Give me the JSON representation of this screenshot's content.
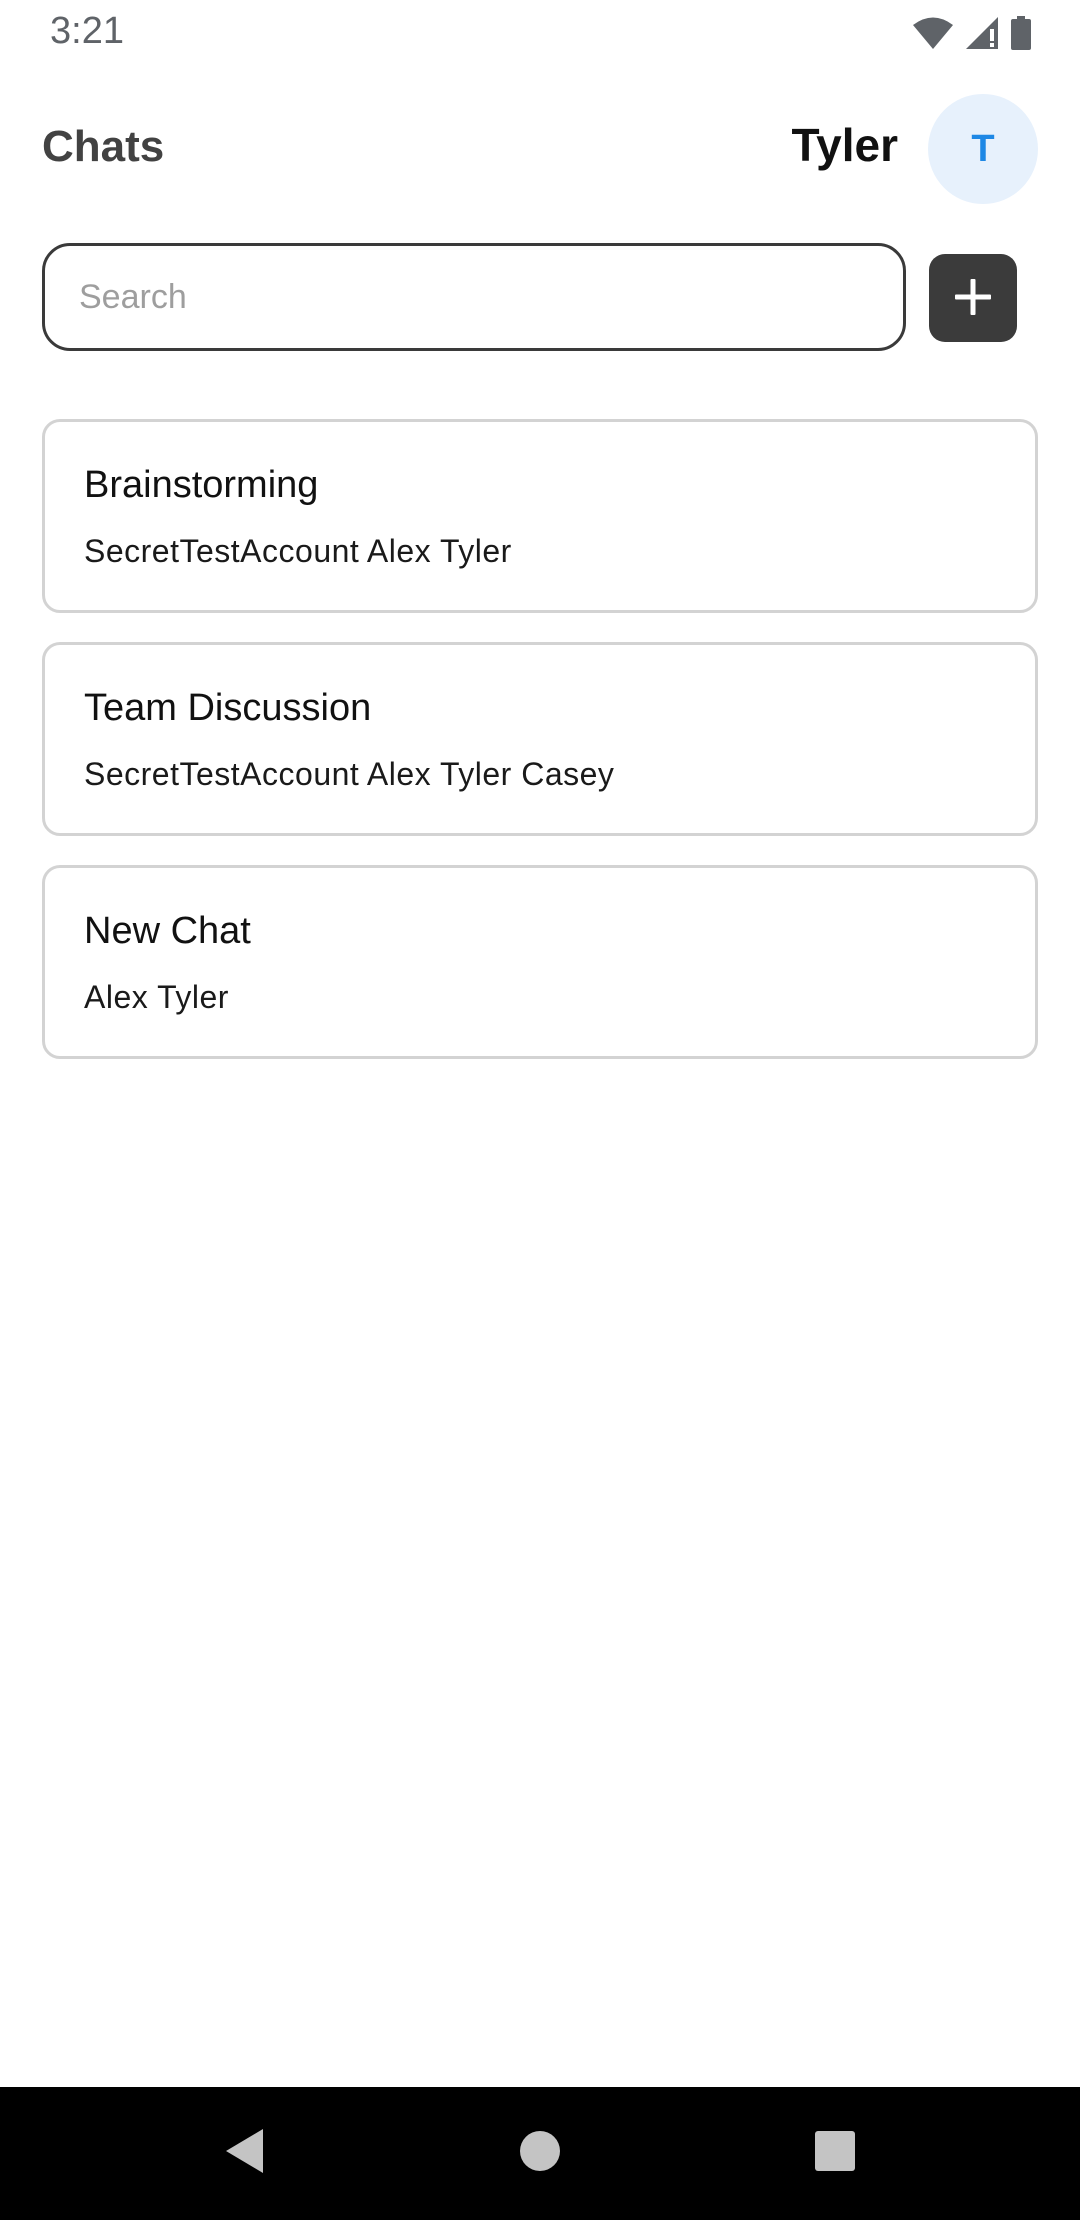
{
  "status_bar": {
    "time": "3:21",
    "icons": [
      "wifi-icon",
      "signal-icon",
      "battery-icon"
    ]
  },
  "header": {
    "title": "Chats",
    "user_name": "Tyler",
    "avatar_initial": "T"
  },
  "search": {
    "placeholder": "Search",
    "value": ""
  },
  "add_button": {
    "icon": "plus-icon"
  },
  "chats": [
    {
      "title": "Brainstorming",
      "members": "SecretTestAccount Alex Tyler"
    },
    {
      "title": "Team Discussion",
      "members": "SecretTestAccount Alex Tyler Casey"
    },
    {
      "title": "New Chat",
      "members": "Alex Tyler"
    }
  ],
  "nav_bar": {
    "icons": [
      "back-icon",
      "home-icon",
      "recents-icon"
    ]
  },
  "colors": {
    "avatar_bg": "#e7f1fc",
    "avatar_text": "#1e88e5",
    "add_button_bg": "#3b3b3b",
    "card_border": "#d3d3d3",
    "nav_bar_bg": "#000000"
  }
}
